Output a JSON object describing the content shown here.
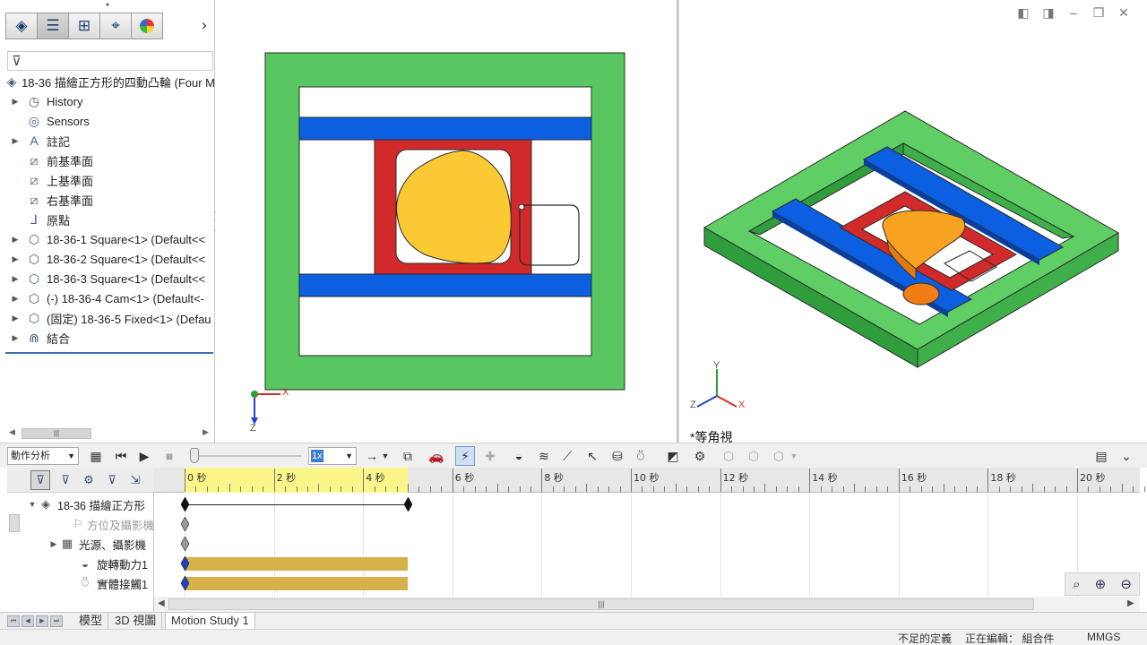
{
  "feature_tree": {
    "root_label": "18-36 描繪正方形的四動凸輪 (Four M",
    "items": [
      {
        "label": "History",
        "expandable": true,
        "icon": "history-icon"
      },
      {
        "label": "Sensors",
        "expandable": false,
        "icon": "sensors-icon"
      },
      {
        "label": "註記",
        "expandable": true,
        "icon": "annotations-icon"
      },
      {
        "label": "前基準面",
        "expandable": false,
        "icon": "plane-icon"
      },
      {
        "label": "上基準面",
        "expandable": false,
        "icon": "plane-icon"
      },
      {
        "label": "右基準面",
        "expandable": false,
        "icon": "plane-icon"
      },
      {
        "label": "原點",
        "expandable": false,
        "icon": "origin-icon"
      },
      {
        "label": "18-36-1 Square<1> (Default<<",
        "expandable": true,
        "icon": "part-icon"
      },
      {
        "label": "18-36-2 Square<1> (Default<<",
        "expandable": true,
        "icon": "part-icon"
      },
      {
        "label": "18-36-3 Square<1> (Default<<",
        "expandable": true,
        "icon": "part-icon"
      },
      {
        "label": "(-) 18-36-4 Cam<1> (Default<-",
        "expandable": true,
        "icon": "part-icon"
      },
      {
        "label": "(固定) 18-36-5 Fixed<1> (Defau",
        "expandable": true,
        "icon": "part-icon"
      },
      {
        "label": "結合",
        "expandable": true,
        "icon": "mates-icon"
      }
    ]
  },
  "viewport_right": {
    "view_name": "*等角視"
  },
  "triad_left": {
    "x": "X",
    "z": "Z"
  },
  "triad_right": {
    "x": "X",
    "y": "Y",
    "z": "Z"
  },
  "motion_toolbar": {
    "study_type": "動作分析",
    "playback_speed": "1x"
  },
  "motion_tree": {
    "rows": [
      {
        "label": "18-36 描繪正方形",
        "expandable": true,
        "dim": false
      },
      {
        "label": "方位及攝影機",
        "expandable": false,
        "dim": true
      },
      {
        "label": "光源、攝影機",
        "expandable": true,
        "dim": false
      },
      {
        "label": "旋轉動力1",
        "expandable": false,
        "dim": false
      },
      {
        "label": "實體接觸1",
        "expandable": false,
        "dim": false
      }
    ]
  },
  "timeline": {
    "tick_labels": [
      "0 秒",
      "2 秒",
      "4 秒",
      "6 秒",
      "8 秒",
      "10 秒",
      "12 秒",
      "14 秒",
      "16 秒",
      "18 秒",
      "20 秒"
    ],
    "ticks_seconds": [
      0,
      2,
      4,
      6,
      8,
      10,
      12,
      14,
      16,
      18,
      20
    ],
    "study_end_seconds": 5,
    "bars": [
      {
        "row": 3,
        "start": 0,
        "end": 5
      },
      {
        "row": 4,
        "start": 0,
        "end": 5
      }
    ]
  },
  "bottom_tabs": [
    "模型",
    "3D 視圖",
    "Motion Study 1"
  ],
  "active_tab": 2,
  "status_bar": {
    "definition": "不足的定義",
    "editing": "正在編輯： 組合件",
    "units": "MMGS"
  },
  "colors": {
    "frame_green": "#59c761",
    "slider_blue": "#0b5fe0",
    "follower_red": "#d22a2a",
    "cam_yellow": "#fbc933",
    "cam_orange": "#f7a321",
    "timeline_bar": "#d6b04b",
    "timeline_highlight": "#fcf58a"
  }
}
